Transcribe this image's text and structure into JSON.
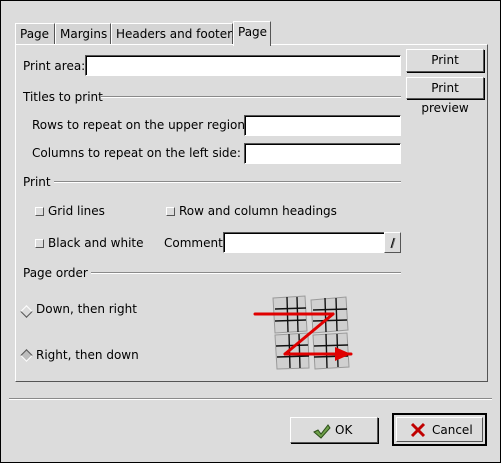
{
  "tabs": [
    {
      "label": "Page",
      "active": false
    },
    {
      "label": "Margins",
      "active": false
    },
    {
      "label": "Headers and footers",
      "active": false
    },
    {
      "label": "Page",
      "active": true
    }
  ],
  "print_area": {
    "label": "Print area:",
    "value": ""
  },
  "buttons": {
    "print": "Print",
    "print_preview": "Print preview",
    "ok": "OK",
    "cancel": "Cancel"
  },
  "titles_section": {
    "heading": "Titles to print",
    "rows_label": "Rows to repeat on the upper region:",
    "rows_value": "",
    "columns_label": "Columns to repeat on the left side:",
    "columns_value": ""
  },
  "print_section": {
    "heading": "Print",
    "grid_lines": {
      "label": "Grid lines",
      "checked": false
    },
    "row_col_headings": {
      "label": "Row and column headings",
      "checked": false
    },
    "black_white": {
      "label": "Black and white",
      "checked": false
    },
    "comments_label": "Comments",
    "comments_value": ""
  },
  "page_order": {
    "heading": "Page order",
    "down_then_right": {
      "label": "Down, then right",
      "selected": false
    },
    "right_then_down": {
      "label": "Right, then down",
      "selected": true
    }
  },
  "colors": {
    "arrow": "#e00000",
    "background": "#dcdcdc"
  }
}
